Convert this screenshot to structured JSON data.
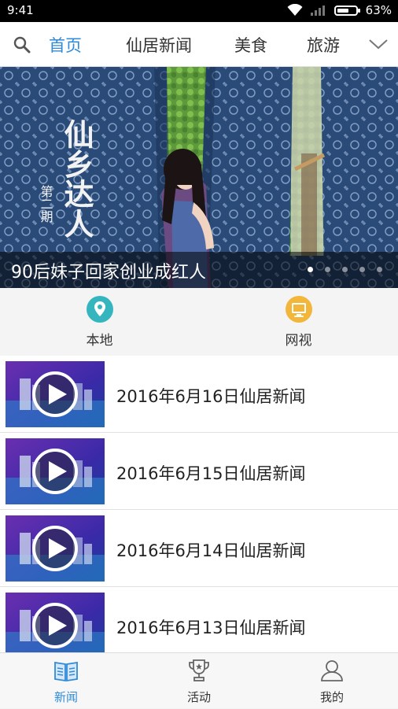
{
  "status_bar": {
    "time": "9:41",
    "battery": "63%",
    "battery_level": 0.63
  },
  "top_nav": {
    "tabs": [
      {
        "label": "首页",
        "active": true
      },
      {
        "label": "仙居新闻",
        "active": false
      },
      {
        "label": "美食",
        "active": false
      },
      {
        "label": "旅游",
        "active": false
      }
    ],
    "icons": {
      "search": "search-icon",
      "expand": "chevron-down-icon"
    }
  },
  "banner": {
    "caption": "90后妹子回家创业成红人",
    "art_title": "仙乡达人",
    "art_issue": "第二期",
    "slide_count": 5,
    "active_slide": 1
  },
  "quick_links": [
    {
      "label": "本地",
      "icon": "location-pin-icon",
      "color": "#35b6bf"
    },
    {
      "label": "网视",
      "icon": "monitor-icon",
      "color": "#f2b63a"
    }
  ],
  "news": [
    {
      "title": "2016年6月16日仙居新闻"
    },
    {
      "title": "2016年6月15日仙居新闻"
    },
    {
      "title": "2016年6月14日仙居新闻"
    },
    {
      "title": "2016年6月13日仙居新闻"
    }
  ],
  "bottom_nav": [
    {
      "label": "新闻",
      "icon": "book-icon",
      "active": true
    },
    {
      "label": "活动",
      "icon": "trophy-icon",
      "active": false
    },
    {
      "label": "我的",
      "icon": "user-icon",
      "active": false
    }
  ],
  "colors": {
    "accent": "#2f8ad8",
    "status_bar": "#000000",
    "nav_bg": "#ffffff"
  }
}
